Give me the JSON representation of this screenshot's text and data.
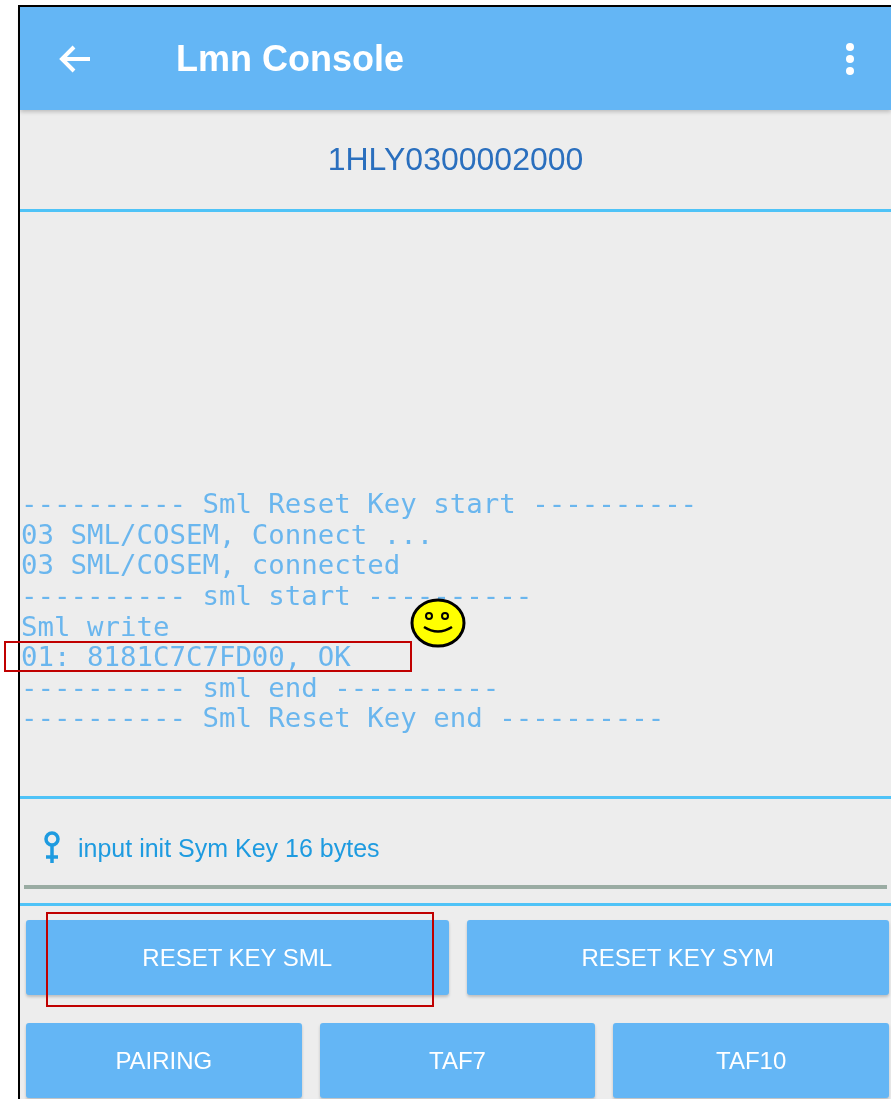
{
  "app_bar": {
    "title": "Lmn Console"
  },
  "device_id": "1HLY0300002000",
  "log": [
    {
      "text": "---------- Sml Reset Key start ----------",
      "highlighted": false
    },
    {
      "text": "03 SML/COSEM, Connect ...",
      "highlighted": false
    },
    {
      "text": "03 SML/COSEM, connected",
      "highlighted": false
    },
    {
      "text": "---------- sml start ----------",
      "highlighted": false
    },
    {
      "text": "Sml write",
      "highlighted": false
    },
    {
      "text": "01: 8181C7C7FD00, OK",
      "highlighted": true
    },
    {
      "text": "---------- sml end ----------",
      "highlighted": false
    },
    {
      "text": "---------- Sml Reset Key end ----------",
      "highlighted": false
    }
  ],
  "key_field": {
    "placeholder": "input init Sym Key 16 bytes"
  },
  "button_rows": [
    [
      {
        "label": "RESET KEY SML",
        "highlighted": true
      },
      {
        "label": "RESET KEY SYM",
        "highlighted": false
      }
    ],
    [
      {
        "label": "PAIRING",
        "highlighted": false
      },
      {
        "label": "TAF7",
        "highlighted": false
      },
      {
        "label": "TAF10",
        "highlighted": false
      }
    ]
  ]
}
